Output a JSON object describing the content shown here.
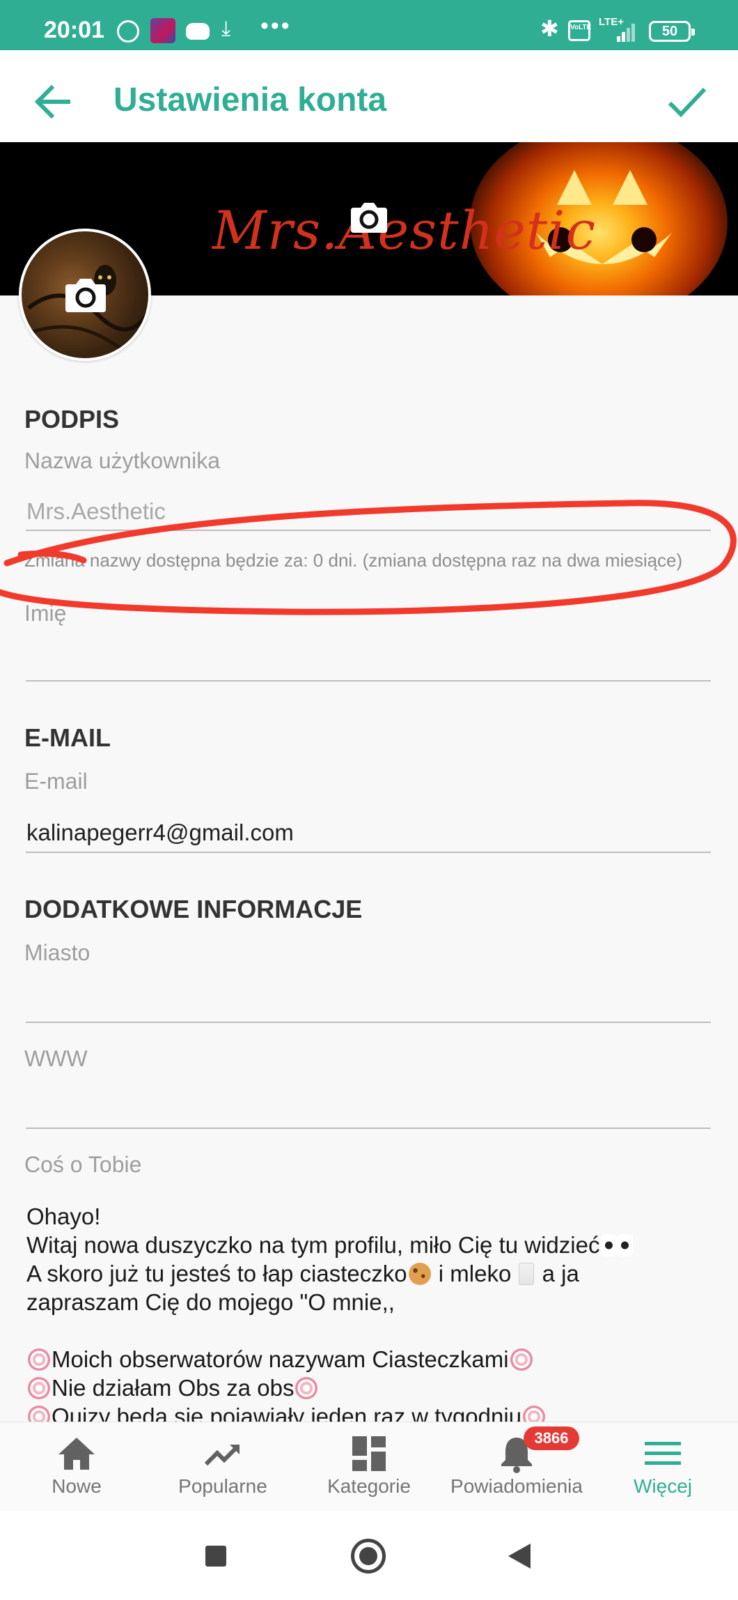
{
  "status_bar": {
    "time": "20:01",
    "icons": [
      "alarm-icon",
      "app-thumbnail-icon",
      "discord-icon",
      "download-icon",
      "more-dots-icon",
      "bluetooth-icon",
      "volte-icon",
      "lte-signal-icon",
      "battery-icon"
    ],
    "volte": "VoLTE",
    "network": "LTE+",
    "battery": "50"
  },
  "appbar": {
    "title": "Ustawienia konta",
    "back_icon": "arrow-left-icon",
    "confirm_icon": "check-icon"
  },
  "cover": {
    "text": "Mrs.Aesthetic"
  },
  "sections": {
    "signature": {
      "heading": "PODPIS",
      "username_label": "Nazwa użytkownika",
      "username_value": "Mrs.Aesthetic",
      "username_hint": "Zmiana nazwy dostępna będzie za: 0 dni. (zmiana dostępna raz na dwa miesiące)",
      "name_label": "Imię",
      "name_value": ""
    },
    "email": {
      "heading": "E-MAIL",
      "email_label": "E-mail",
      "email_value": "kalinapegerr4@gmail.com"
    },
    "extra": {
      "heading": "DODATKOWE INFORMACJE",
      "city_label": "Miasto",
      "city_value": "",
      "www_label": "WWW",
      "www_value": "",
      "about_label": "Coś o Tobie",
      "about_lines": [
        "Ohayo!",
        "Witaj nowa duszyczko na tym profilu, miło Cię tu widzieć",
        "A skoro już tu jesteś to łap ciasteczko",
        " i mleko ",
        " a ja",
        "zapraszam Cię do mojego \"O mnie,,",
        "Moich obserwatorów nazywam Ciasteczkami",
        "Nie działam Obs za obs",
        "Quizy będą się pojawiały jeden raz w tygodniu"
      ]
    }
  },
  "bottom_nav": {
    "items": [
      {
        "label": "Nowe",
        "icon": "home-icon"
      },
      {
        "label": "Popularne",
        "icon": "trending-icon"
      },
      {
        "label": "Kategorie",
        "icon": "dashboard-icon"
      },
      {
        "label": "Powiadomienia",
        "icon": "bell-icon",
        "badge": "3866"
      },
      {
        "label": "Więcej",
        "icon": "menu-icon",
        "active": true
      }
    ]
  },
  "colors": {
    "accent": "#2fae94",
    "badge": "#e53935",
    "annotation": "#f23a2c"
  }
}
